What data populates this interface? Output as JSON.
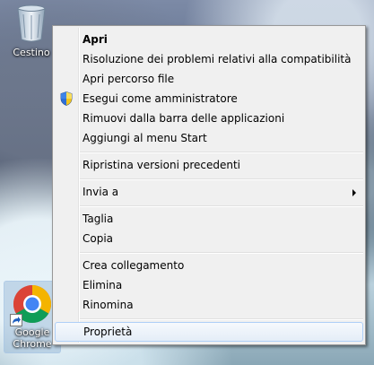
{
  "desktop": {
    "icons": [
      {
        "label": "Cestino",
        "icon": "recycle-bin-icon"
      },
      {
        "label": "Google Chrome",
        "icon": "chrome-icon"
      }
    ]
  },
  "context_menu": {
    "items": [
      {
        "label": "Apri",
        "bold": true
      },
      {
        "label": "Risoluzione dei problemi relativi alla compatibilità"
      },
      {
        "label": "Apri percorso file"
      },
      {
        "label": "Esegui come amministratore",
        "icon": "uac-shield-icon"
      },
      {
        "label": "Rimuovi dalla barra delle applicazioni"
      },
      {
        "label": "Aggiungi al menu Start"
      },
      {
        "label": "Ripristina versioni precedenti"
      },
      {
        "label": "Invia a",
        "submenu": true
      },
      {
        "label": "Taglia"
      },
      {
        "label": "Copia"
      },
      {
        "label": "Crea collegamento"
      },
      {
        "label": "Elimina"
      },
      {
        "label": "Rinomina"
      },
      {
        "label": "Proprietà",
        "highlighted": true
      }
    ]
  },
  "colors": {
    "menu_background": "#f0f0f0",
    "menu_border": "#979797",
    "highlight_border": "#aecff7"
  }
}
